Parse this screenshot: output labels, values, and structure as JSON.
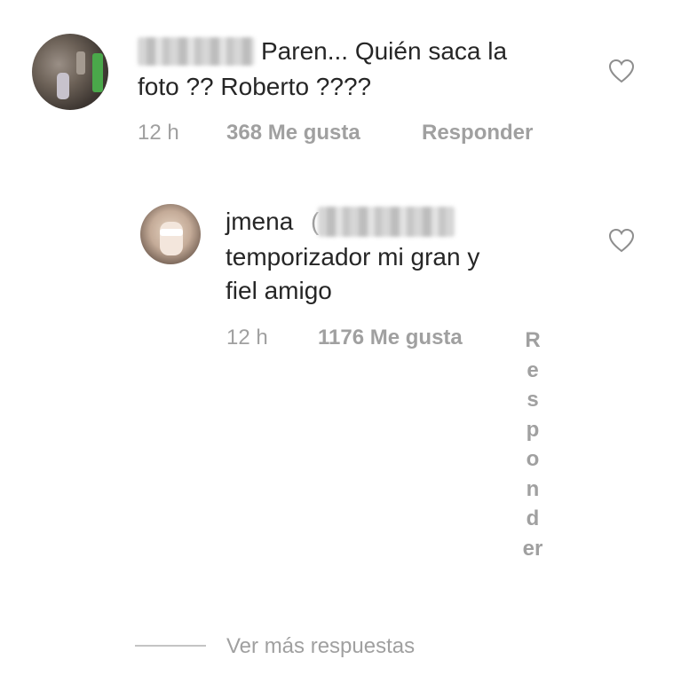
{
  "comments": [
    {
      "text_line1": "Paren... Quién saca la",
      "text_line2": "foto ??   Roberto ????",
      "time": "12 h",
      "likes": "368 Me gusta",
      "reply_label": "Responder"
    }
  ],
  "reply": {
    "username": "jmena",
    "paren": "(",
    "text_line1": "temporizador mi gran y",
    "text_line2": "fiel amigo",
    "time": "12 h",
    "likes": "1176 Me gusta",
    "reply_label": "Responder"
  },
  "more_replies_label": "Ver más respuestas",
  "icons": {
    "like": "heart-icon"
  },
  "colors": {
    "text": "#262626",
    "meta": "#a0a0a0"
  }
}
